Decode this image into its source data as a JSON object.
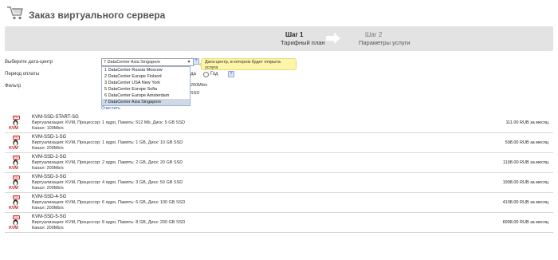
{
  "header": {
    "title": "Заказ виртуального сервера"
  },
  "steps": {
    "step1": {
      "title": "Шаг 1",
      "subtitle": "Тарифный план"
    },
    "step2": {
      "title": "Шаг 2",
      "subtitle": "Параметры услуги"
    }
  },
  "form": {
    "datacenter_label": "Выберите дата-центр",
    "period_label": "Период оплаты",
    "filter_label": "Фильтр",
    "datacenter_selected": "7 DataCenter Asia Singapore",
    "datacenter_tooltip": "Дата-центр, в котором будет открыта услуга",
    "datacenter_options": [
      "1 DataCenter Russia Moscow",
      "2 DataCenter Europe Finland",
      "3 DataCenter USA New York",
      "5 DataCenter Europe Sofia",
      "6 DataCenter Europe Amsterdam",
      "7 DataCenter Asia Singapore"
    ],
    "period_partial": "да",
    "period_year": "Год",
    "help_glyph": "?",
    "filter_speed_partial": "200Mb/s",
    "filter_ssd_partial": "SSD",
    "clear_link": "Очистить"
  },
  "products": [
    {
      "name": "KVM-SSD-START-SG",
      "spec": "Виртуализация: KVM, Процессор: 1 ядро, Память: 512 Mb, Диск: 5 GB SSD",
      "channel": "Канал: 100Mb/s",
      "price": "111.00 RUB за месяц",
      "badge": "KVM",
      "tag": "SSD"
    },
    {
      "name": "KVM-SSD-1-SG",
      "spec": "Виртуализация: KVM, Процессор: 1 ядро, Память: 1 GB, Диск: 10 GB SSD",
      "channel": "Канал: 200Mb/s",
      "price": "598.00 RUB за месяц",
      "badge": "KVM",
      "tag": "SSD"
    },
    {
      "name": "KVM-SSD-2-SG",
      "spec": "Виртуализация: KVM, Процессор: 2 ядро, Память: 2 GB, Диск: 20 GB SSD",
      "channel": "Канал: 200Mb/s",
      "price": "1198.00 RUB за месяц",
      "badge": "KVM",
      "tag": "SSD"
    },
    {
      "name": "KVM-SSD-3-SG",
      "spec": "Виртуализация: KVM, Процессор: 4 ядро, Память: 3 GB, Диск: 50 GB SSD",
      "channel": "Канал: 200Mb/s",
      "price": "1998.00 RUB за месяц",
      "badge": "KVM",
      "tag": "SSD"
    },
    {
      "name": "KVM-SSD-4-SG",
      "spec": "Виртуализация: KVM, Процессор: 6 ядро, Память: 6 GB, Диск: 100 GB SSD",
      "channel": "Канал: 200Mb/s",
      "price": "4198.00 RUB за месяц",
      "badge": "KVM",
      "tag": "SSD"
    },
    {
      "name": "KVM-SSD-5-SG",
      "spec": "Виртуализация: KVM, Процессор: 8 ядро, Память: 8 GB, Диск: 200 GB SSD",
      "channel": "Канал: 200Mb/s",
      "price": "6998.00 RUB за месяц",
      "badge": "KVM",
      "tag": "SSD"
    }
  ]
}
